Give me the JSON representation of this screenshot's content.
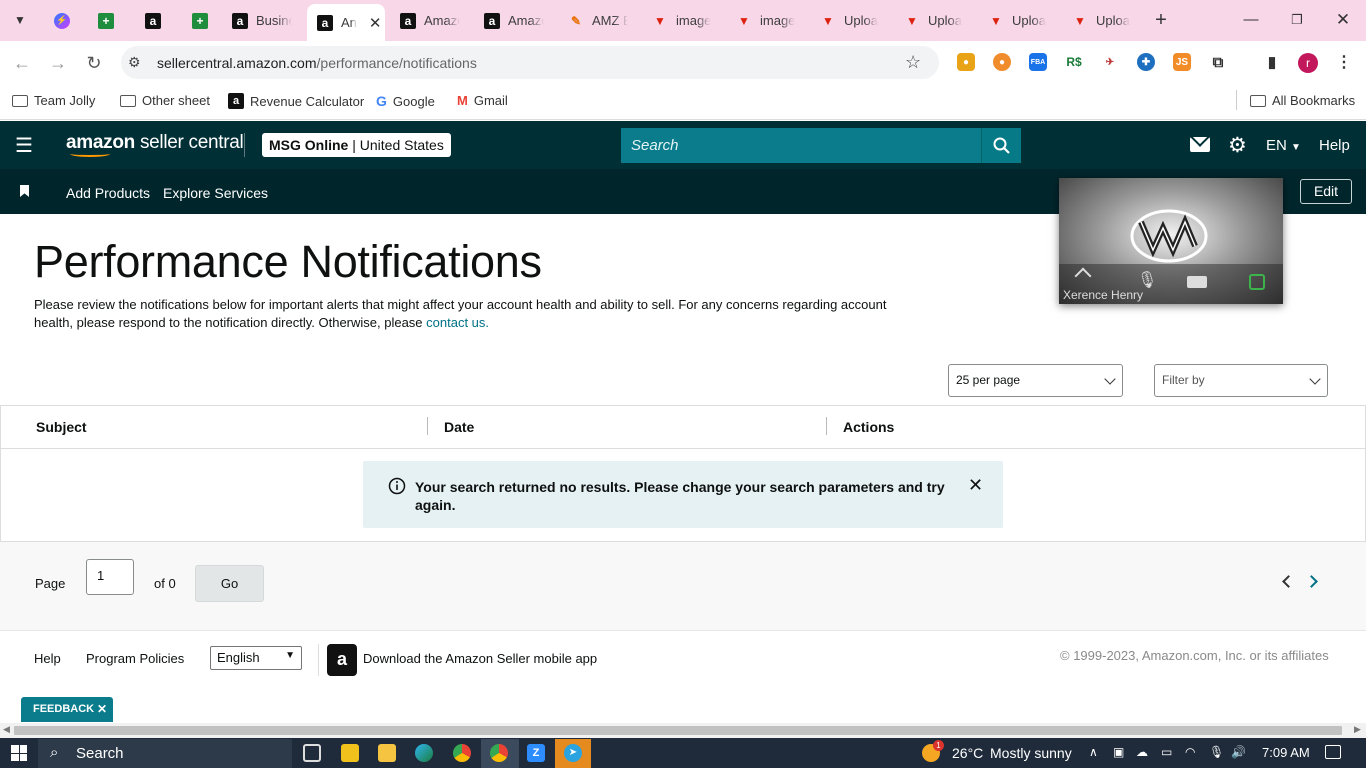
{
  "browser": {
    "tabs": [
      {
        "title": "",
        "icon": "chevron-down-icon"
      },
      {
        "title": "",
        "icon": "messenger-icon"
      },
      {
        "title": "",
        "icon": "google-sheets-icon"
      },
      {
        "title": "",
        "icon": "amazon-icon"
      },
      {
        "title": "",
        "icon": "google-sheets-icon"
      },
      {
        "title": "Busine",
        "icon": "amazon-icon"
      },
      {
        "title": "An",
        "icon": "amazon-icon",
        "active": true
      },
      {
        "title": "Amazo",
        "icon": "amazon-icon"
      },
      {
        "title": "Amazo",
        "icon": "amazon-icon"
      },
      {
        "title": "AMZ E",
        "icon": "pencil-icon"
      },
      {
        "title": "image",
        "icon": "filter-icon"
      },
      {
        "title": "image",
        "icon": "filter-icon"
      },
      {
        "title": "Uploa",
        "icon": "filter-icon"
      },
      {
        "title": "Uploa",
        "icon": "filter-icon"
      },
      {
        "title": "Uploa",
        "icon": "filter-icon"
      },
      {
        "title": "Uploa",
        "icon": "filter-icon"
      }
    ],
    "url_domain": "sellercentral.amazon.com",
    "url_path": "/performance/notifications",
    "bookmarks": [
      "Team Jolly",
      "Other sheet",
      "Revenue Calculator",
      "Google",
      "Gmail"
    ],
    "all_bookmarks": "All Bookmarks",
    "profile_initial": "r"
  },
  "header": {
    "logo_amazon": "amazon",
    "logo_seller_central": "seller central",
    "store_name": "MSG Online",
    "store_region": "United States",
    "search_placeholder": "Search",
    "language": "EN",
    "help": "Help"
  },
  "nav": {
    "items": [
      "Add Products",
      "Explore Services"
    ],
    "edit": "Edit"
  },
  "video_call": {
    "participant": "Xerence Henry"
  },
  "page": {
    "title": "Performance Notifications",
    "description": "Please review the notifications below for important alerts that might affect your account health and ability to sell. For any concerns regarding account health, please respond to the notification directly. Otherwise, please ",
    "contact_link": "contact us."
  },
  "controls": {
    "per_page": "25 per page",
    "filter_placeholder": "Filter by"
  },
  "table": {
    "columns": [
      "Subject",
      "Date",
      "Actions"
    ],
    "empty_message": "Your search returned no results. Please change your search parameters and try again."
  },
  "pagination": {
    "page_label": "Page",
    "current_page": "1",
    "of_label": "of 0",
    "go": "Go"
  },
  "footer": {
    "help": "Help",
    "program_policies": "Program Policies",
    "language_option": "English",
    "mobile_app": "Download the Amazon Seller mobile app",
    "copyright": "© 1999-2023, Amazon.com, Inc. or its affiliates"
  },
  "feedback": "FEEDBACK",
  "taskbar": {
    "search": "Search",
    "weather_temp": "26°C",
    "weather_desc": "Mostly sunny",
    "time": "7:09 AM",
    "weather_badge": "1"
  },
  "colors": {
    "header_bg": "#002f36",
    "nav_bg": "#00262c",
    "accent": "#0a7c8c",
    "link": "#007185",
    "tabstrip": "#f8d7e8"
  }
}
